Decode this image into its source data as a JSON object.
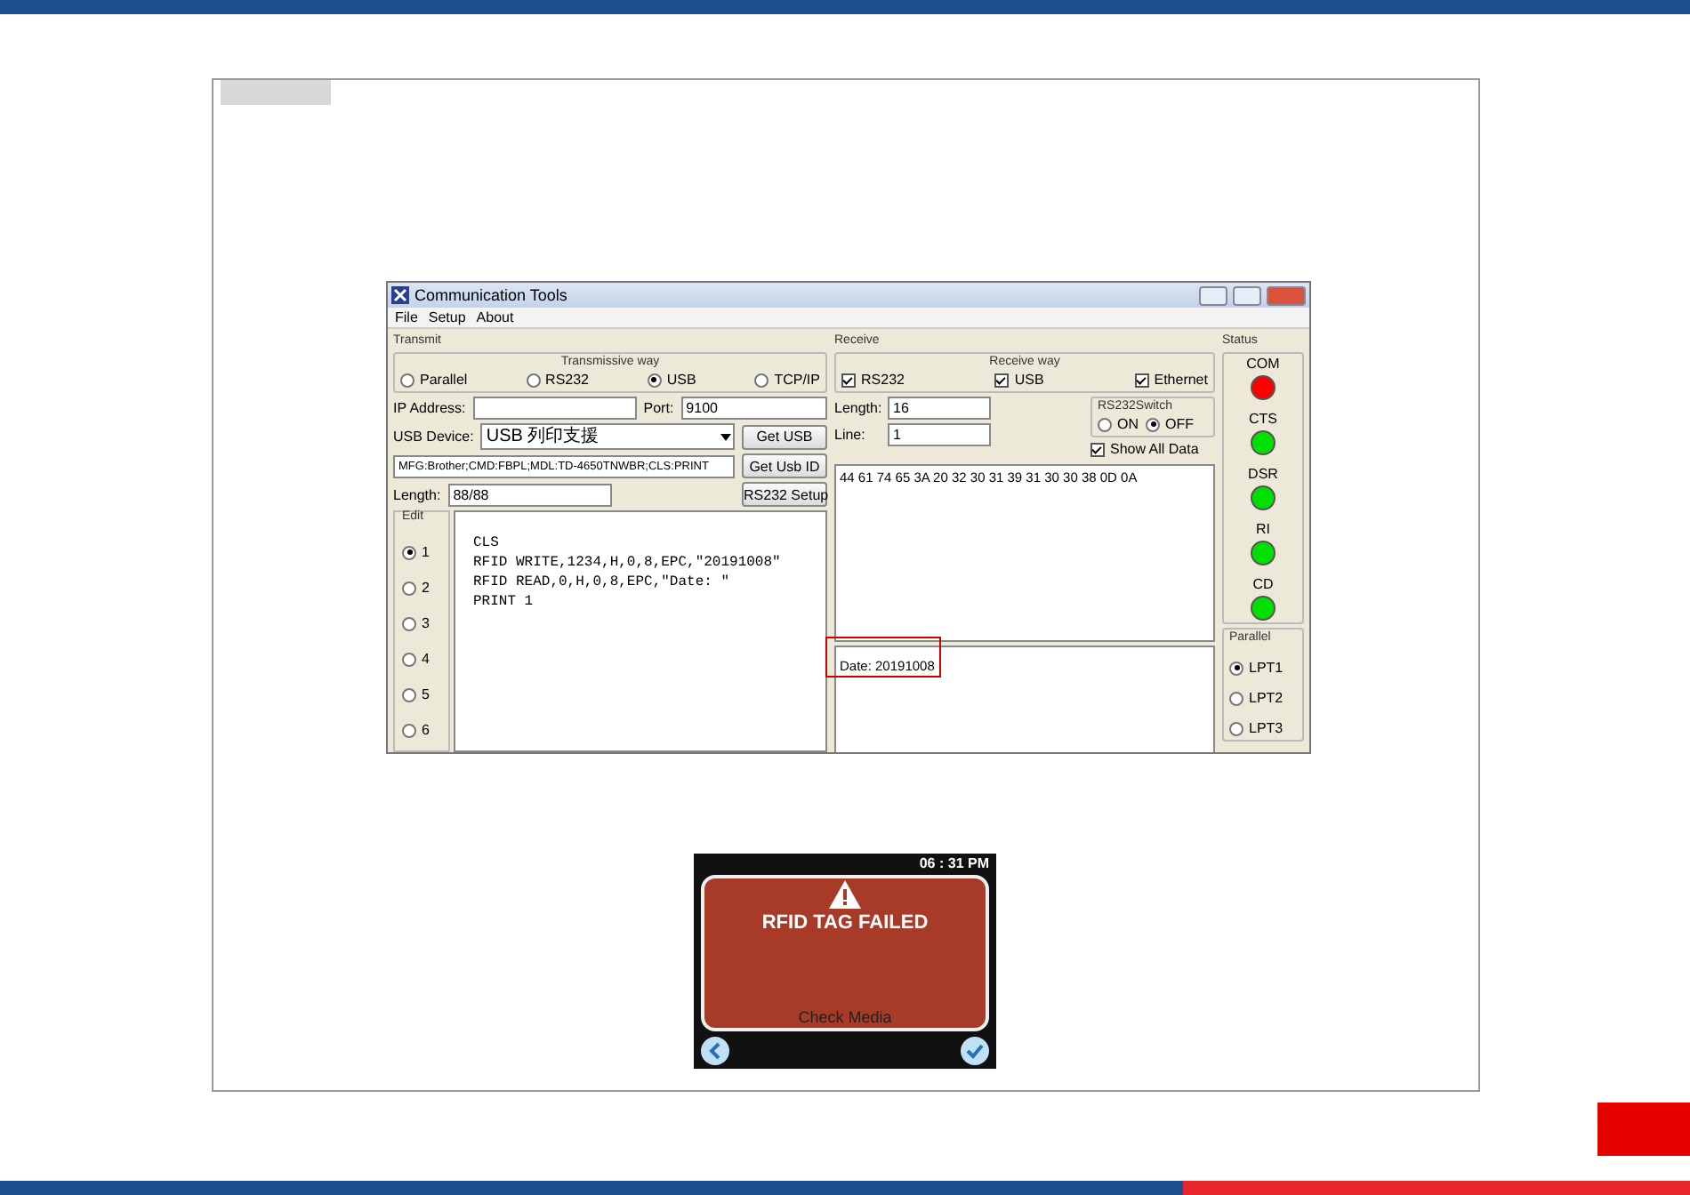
{
  "window": {
    "title": "Communication Tools",
    "menu": [
      "File",
      "Setup",
      "About"
    ],
    "transmit": {
      "title": "Transmit",
      "way_title": "Transmissive way",
      "ways": [
        {
          "label": "Parallel",
          "selected": false
        },
        {
          "label": "RS232",
          "selected": false
        },
        {
          "label": "USB",
          "selected": true
        },
        {
          "label": "TCP/IP",
          "selected": false
        }
      ],
      "ip_label": "IP Address:",
      "port_label": "Port:",
      "port_value": "9100",
      "usb_label": "USB Device:",
      "usb_value": "USB 列印支援",
      "get_usb": "Get USB",
      "device_id": "MFG:Brother;CMD:FBPL;MDL:TD-4650TNWBR;CLS:PRINT",
      "get_usb_id": "Get Usb ID",
      "length_label": "Length:",
      "length_value": "88/88",
      "rs232_setup": "RS232 Setup",
      "edit_title": "Edit",
      "edit_slots": [
        {
          "label": "1",
          "selected": true
        },
        {
          "label": "2",
          "selected": false
        },
        {
          "label": "3",
          "selected": false
        },
        {
          "label": "4",
          "selected": false
        },
        {
          "label": "5",
          "selected": false
        },
        {
          "label": "6",
          "selected": false
        }
      ],
      "editor_lines": [
        "CLS",
        "RFID WRITE,1234,H,0,8,EPC,\"20191008\"",
        "RFID READ,0,H,0,8,EPC,\"Date: \"",
        "PRINT 1"
      ]
    },
    "receive": {
      "title": "Receive",
      "way_title": "Receive way",
      "ways": [
        {
          "label": "RS232",
          "checked": true
        },
        {
          "label": "USB",
          "checked": true
        },
        {
          "label": "Ethernet",
          "checked": true
        }
      ],
      "length_label": "Length:",
      "length_value": "16",
      "line_label": "Line:",
      "line_value": "1",
      "switch_title": "RS232Switch",
      "switch_options": [
        {
          "label": "ON",
          "selected": false
        },
        {
          "label": "OFF",
          "selected": true
        }
      ],
      "show_all": {
        "label": "Show All Data",
        "checked": true
      },
      "hex": "44 61 74 65 3A 20 32 30 31 39 31 30 30 38 0D 0A",
      "output": "Date: 20191008"
    },
    "status": {
      "title": "Status",
      "lights": [
        {
          "label": "COM",
          "color": "#ff0000"
        },
        {
          "label": "CTS",
          "color": "#00e000"
        },
        {
          "label": "DSR",
          "color": "#00e000"
        },
        {
          "label": "RI",
          "color": "#00e000"
        },
        {
          "label": "CD",
          "color": "#00e000"
        }
      ]
    },
    "parallel": {
      "title": "Parallel",
      "ports": [
        {
          "label": "LPT1",
          "selected": true
        },
        {
          "label": "LPT2",
          "selected": false
        },
        {
          "label": "LPT3",
          "selected": false
        }
      ]
    }
  },
  "display": {
    "time": "06 : 31 PM",
    "message": "RFID TAG FAILED",
    "hint": "Check Media"
  }
}
